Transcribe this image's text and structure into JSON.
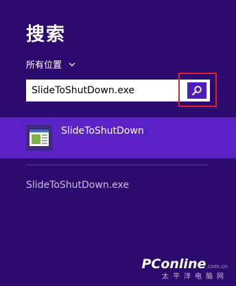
{
  "search_panel": {
    "title": "搜索",
    "scope_label": "所有位置",
    "search_value": "SlideToShutDown.exe"
  },
  "results": {
    "app_name": "SlideToShutDown",
    "suggestion": "SlideToShutDown.exe"
  },
  "watermark": {
    "brand": "PConline",
    "domain_suffix": ".com.cn",
    "subtitle": "太平洋电脑网"
  },
  "colors": {
    "background": "#2d0a6d",
    "accent": "#5a22c6",
    "highlight_box": "#e0202a"
  }
}
